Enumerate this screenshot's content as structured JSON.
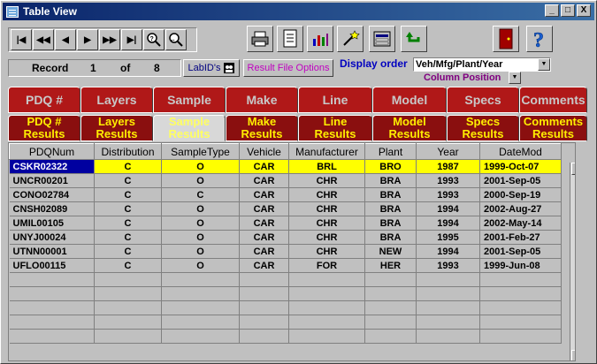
{
  "window": {
    "title": "Table View"
  },
  "window_buttons": {
    "minimize": "_",
    "restore": "□",
    "close": "X"
  },
  "record": {
    "label": "Record",
    "current": "1",
    "of_label": "of",
    "total": "8"
  },
  "buttons": {
    "labids": "LabID's",
    "result_file_options": "Result File Options"
  },
  "display_order": {
    "label": "Display order",
    "value": "Veh/Mfg/Plant/Year"
  },
  "column_position": {
    "label": "Column Position"
  },
  "tabs_top": [
    "PDQ #",
    "Layers",
    "Sample",
    "Make",
    "Line",
    "Model",
    "Specs",
    "Comments"
  ],
  "tabs_results": [
    [
      "PDQ #",
      "Results"
    ],
    [
      "Layers",
      "Results"
    ],
    [
      "Sample",
      "Results"
    ],
    [
      "Make",
      "Results"
    ],
    [
      "Line",
      "Results"
    ],
    [
      "Model",
      "Results"
    ],
    [
      "Specs",
      "Results"
    ],
    [
      "Comments",
      "Results"
    ]
  ],
  "active_results_tab": 2,
  "table": {
    "columns": [
      "PDQNum",
      "Distribution",
      "SampleType",
      "Vehicle",
      "Manufacturer",
      "Plant",
      "Year",
      "DateMod"
    ],
    "rows": [
      [
        "CSKR02322",
        "C",
        "O",
        "CAR",
        "BRL",
        "BRO",
        "1987",
        "1999-Oct-07"
      ],
      [
        "UNCR00201",
        "C",
        "O",
        "CAR",
        "CHR",
        "BRA",
        "1993",
        "2001-Sep-05"
      ],
      [
        "CONO02784",
        "C",
        "C",
        "CAR",
        "CHR",
        "BRA",
        "1993",
        "2000-Sep-19"
      ],
      [
        "CNSH02089",
        "C",
        "O",
        "CAR",
        "CHR",
        "BRA",
        "1994",
        "2002-Aug-27"
      ],
      [
        "UMIL00105",
        "C",
        "O",
        "CAR",
        "CHR",
        "BRA",
        "1994",
        "2002-May-14"
      ],
      [
        "UNYJ00024",
        "C",
        "O",
        "CAR",
        "CHR",
        "BRA",
        "1995",
        "2001-Feb-27"
      ],
      [
        "UTNN00001",
        "C",
        "O",
        "CAR",
        "CHR",
        "NEW",
        "1994",
        "2001-Sep-05"
      ],
      [
        "UFLO00115",
        "C",
        "O",
        "CAR",
        "FOR",
        "HER",
        "1993",
        "1999-Jun-08"
      ]
    ]
  },
  "colors": {
    "tab_red": "#b01818",
    "tab_results": "#8a0f0f",
    "highlight": "#ffff00",
    "selection": "#0000a0"
  }
}
